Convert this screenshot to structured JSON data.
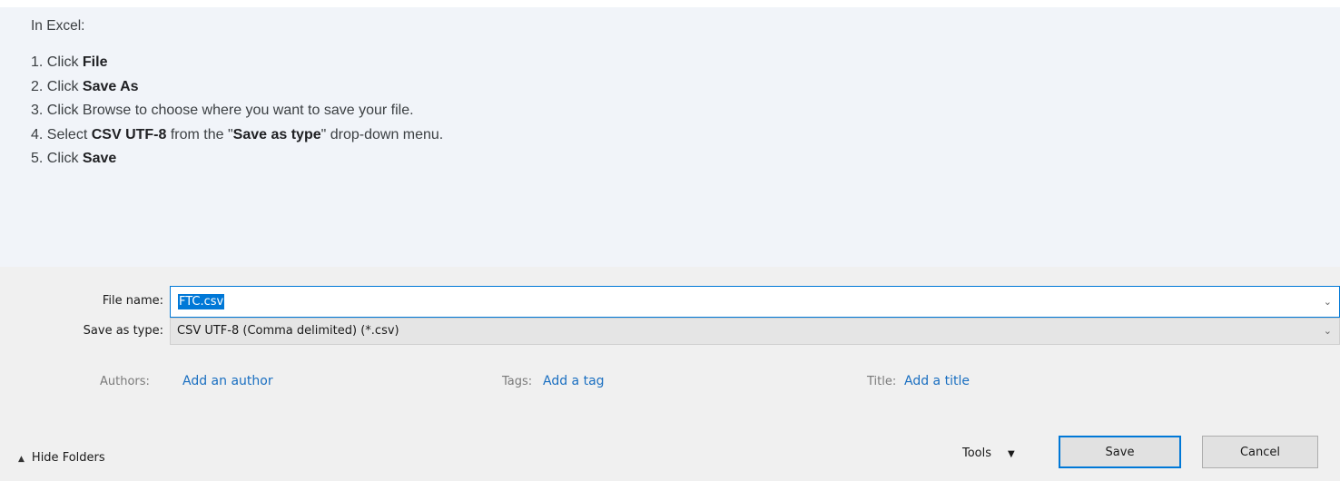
{
  "instructions": {
    "intro": "In Excel:",
    "steps": [
      {
        "num": "1.",
        "pre": "Click ",
        "bold": "File",
        "mid": "",
        "bold2": "",
        "post": ""
      },
      {
        "num": "2.",
        "pre": "Click ",
        "bold": "Save As",
        "mid": "",
        "bold2": "",
        "post": ""
      },
      {
        "num": "3.",
        "pre": "Click Browse to choose where you want to save your file.",
        "bold": "",
        "mid": "",
        "bold2": "",
        "post": ""
      },
      {
        "num": "4.",
        "pre": "Select ",
        "bold": "CSV UTF-8",
        "mid": " from the \"",
        "bold2": "Save as type",
        "post": "\" drop-down menu."
      },
      {
        "num": "5.",
        "pre": "Click ",
        "bold": "Save",
        "mid": "",
        "bold2": "",
        "post": ""
      }
    ]
  },
  "dialog": {
    "file_name_label": "File name:",
    "file_name_value": "FTC.csv",
    "save_as_type_label": "Save as type:",
    "save_as_type_value": "CSV UTF-8 (Comma delimited) (*.csv)",
    "authors_label": "Authors:",
    "authors_link": "Add an author",
    "tags_label": "Tags:",
    "tags_link": "Add a tag",
    "title_label": "Title:",
    "title_link": "Add a title",
    "hide_folders_label": "Hide Folders",
    "tools_label": "Tools",
    "save_button": "Save",
    "cancel_button": "Cancel"
  },
  "icons": {
    "dropdown": "chevron-down-icon",
    "tools_arrow": "triangle-down-icon",
    "hide_folders": "caret-up-icon"
  },
  "colors": {
    "accent": "#0078d7",
    "link": "#1a6fc1"
  }
}
